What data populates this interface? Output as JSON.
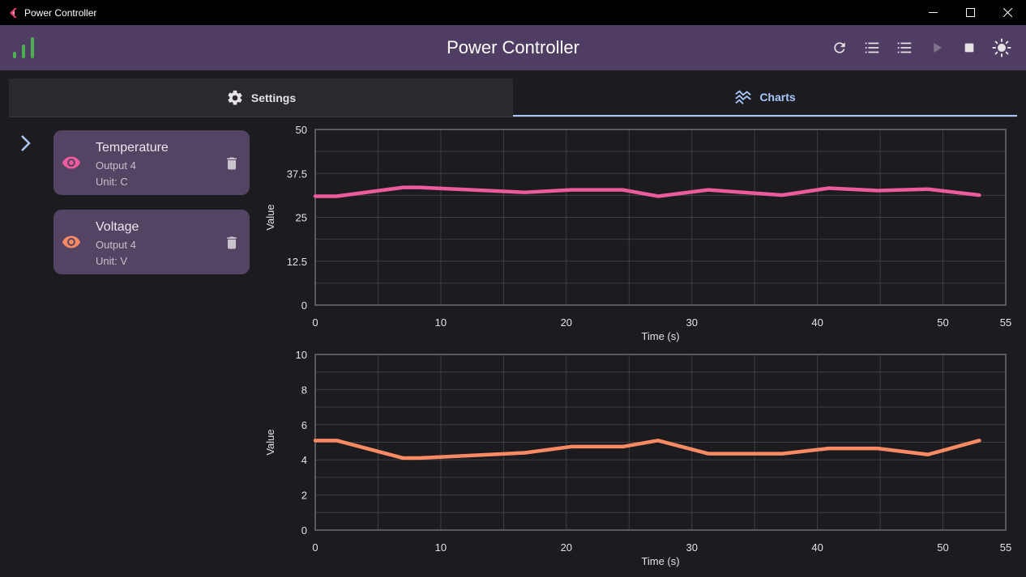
{
  "window": {
    "title": "Power Controller"
  },
  "appbar": {
    "title": "Power Controller"
  },
  "tabs": [
    {
      "label": "Settings",
      "icon": "gear-icon"
    },
    {
      "label": "Charts",
      "icon": "chart-icon"
    }
  ],
  "colors": {
    "appbar": "#4f3d63",
    "temperature": "#ec5b9b",
    "voltage": "#f98a63",
    "tab_active": "#a8c7fa",
    "signal": "#4caf50"
  },
  "channels": [
    {
      "name": "Temperature",
      "output": "Output 4",
      "unit": "Unit: C"
    },
    {
      "name": "Voltage",
      "output": "Output 4",
      "unit": "Unit: V"
    }
  ],
  "chart_data": [
    {
      "type": "line",
      "title": "",
      "xlabel": "Time (s)",
      "ylabel": "Value",
      "xlim": [
        0,
        55
      ],
      "ylim": [
        0,
        50
      ],
      "xticks": [
        "0",
        "10",
        "20",
        "30",
        "40",
        "50",
        "55"
      ],
      "yticks": [
        "0",
        "12.5",
        "25",
        "37.5",
        "50"
      ],
      "grid": true,
      "series": [
        {
          "color": "#ec5b9b",
          "x": [
            0,
            1.7,
            7,
            8.3,
            16.7,
            20.4,
            24.5,
            27.3,
            31.3,
            37.2,
            40.9,
            44.8,
            48.8,
            52.9
          ],
          "y": [
            31,
            31,
            33.5,
            33.5,
            32.1,
            32.8,
            32.8,
            31,
            32.8,
            31.3,
            33.3,
            32.6,
            33,
            31.3
          ]
        }
      ]
    },
    {
      "type": "line",
      "title": "",
      "xlabel": "Time (s)",
      "ylabel": "Value",
      "xlim": [
        0,
        55
      ],
      "ylim": [
        0,
        10
      ],
      "xticks": [
        "0",
        "10",
        "20",
        "30",
        "40",
        "50",
        "55"
      ],
      "yticks": [
        "0",
        "2",
        "4",
        "6",
        "8",
        "10"
      ],
      "grid": true,
      "series": [
        {
          "color": "#f98a63",
          "x": [
            0,
            1.7,
            7,
            8.3,
            16.7,
            20.4,
            24.5,
            27.3,
            31.3,
            37.2,
            40.9,
            44.8,
            48.8,
            52.9
          ],
          "y": [
            5.1,
            5.1,
            4.1,
            4.1,
            4.4,
            4.75,
            4.75,
            5.1,
            4.35,
            4.35,
            4.65,
            4.65,
            4.3,
            5.1
          ]
        }
      ]
    }
  ]
}
